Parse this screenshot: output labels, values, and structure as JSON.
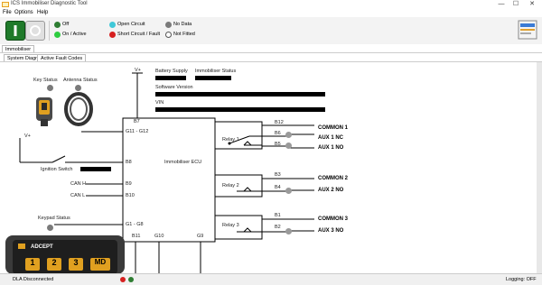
{
  "window": {
    "title": "ICS Immobiliser Diagnostic Tool",
    "min": "—",
    "max": "☐",
    "close": "✕"
  },
  "menu": {
    "items": [
      "File",
      "Options",
      "Help"
    ]
  },
  "legend": {
    "off": "Off",
    "on_active": "On / Active",
    "open_circuit": "Open Circuit",
    "short_circuit": "Short Circuit / Fault",
    "no_data": "No Data",
    "not_fitted": "Not Fitted",
    "colors": {
      "off": "#2e7d32",
      "on": "#2ecc40",
      "open": "#40c8d8",
      "short": "#d62020",
      "nodata": "#7a7a7a",
      "notfitted": "#ffffff"
    }
  },
  "tabs": {
    "top": "Immobiliser",
    "system_diagram": "System Diagram",
    "active_fault_codes": "Active Fault Codes"
  },
  "diagram": {
    "key_status": "Key Status",
    "antenna_status": "Antenna Status",
    "battery_supply": "Battery Supply",
    "immobiliser_status": "Immobiliser Status",
    "software_version": "Software Version",
    "vin": "VIN",
    "ignition_switch": "Ignition Switch",
    "can_h": "CAN H",
    "can_l": "CAN L",
    "keypad_status": "Keypad Status",
    "ecu": "Immobiliser ECU",
    "vplus_top": "V+",
    "vplus_left": "V+",
    "pins": {
      "b7": "B7",
      "g11_g12": "G11 - G12",
      "b8": "B8",
      "b9": "B9",
      "b10": "B10",
      "g1_g8": "G1 - G8",
      "b11": "B11",
      "g10": "G10",
      "g9": "G9",
      "b12": "B12",
      "b6": "B6",
      "b5": "B5",
      "b3": "B3",
      "b4": "B4",
      "b1": "B1",
      "b2": "B2"
    },
    "relay1": "Relay 1",
    "relay2": "Relay 2",
    "relay3": "Relay 3",
    "outputs": {
      "common1": "COMMON 1",
      "aux1nc": "AUX 1 NC",
      "aux1no": "AUX 1 NO",
      "common2": "COMMON 2",
      "aux2no": "AUX 2 NO",
      "common3": "COMMON 3",
      "aux3no": "AUX 3 NO"
    },
    "keypad": {
      "brand": "ADCEPT",
      "k1": "1",
      "k2": "2",
      "k3": "3",
      "k4": "MD"
    }
  },
  "status": {
    "left": "DLA Disconnected",
    "right": "Logging: OFF"
  }
}
